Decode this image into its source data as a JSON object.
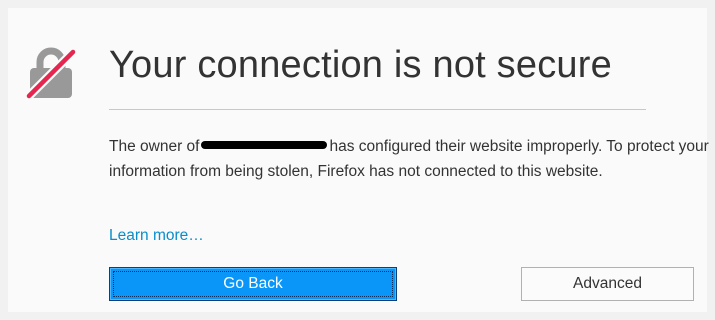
{
  "error_page": {
    "title": "Your connection is not secure",
    "description": {
      "prefix": "The owner of",
      "suffix": "has configured their website improperly. To protect your information from being stolen, Firefox has not connected to this website."
    },
    "learn_more": "Learn more…",
    "buttons": {
      "go_back": "Go Back",
      "advanced": "Advanced"
    },
    "icon": "broken-lock-icon"
  },
  "colors": {
    "accent": "#0996f8",
    "link": "#0a8dcc",
    "icon_slash": "#e22850",
    "icon_gray": "#999999"
  }
}
